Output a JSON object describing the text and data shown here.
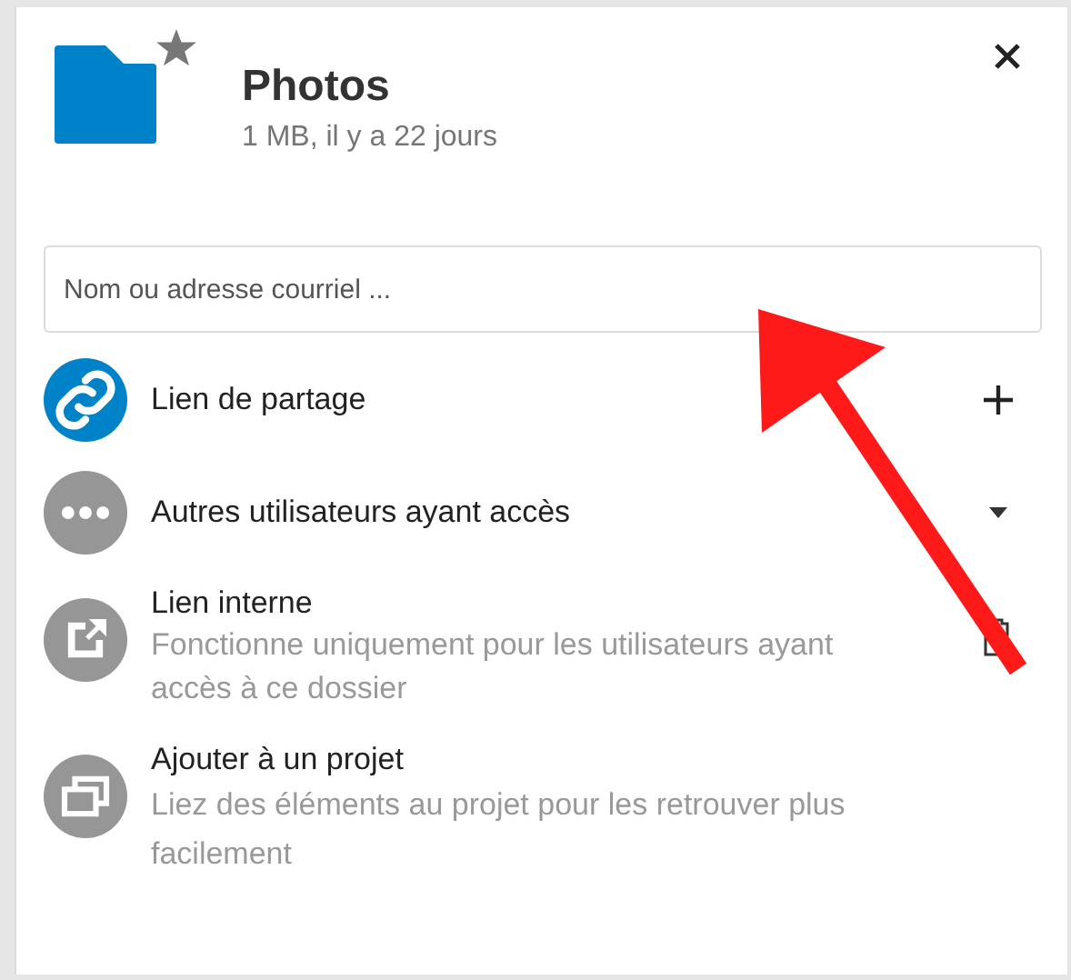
{
  "header": {
    "title": "Photos",
    "subtitle": "1 MB, il y a 22 jours",
    "favorite": true
  },
  "search": {
    "placeholder": "Nom ou adresse courriel ..."
  },
  "entries": [
    {
      "kind": "share",
      "title": "Lien de partage"
    },
    {
      "kind": "others",
      "title": "Autres utilisateurs ayant accès"
    },
    {
      "kind": "internal",
      "title": "Lien interne",
      "subtitle": "Fonctionne uniquement pour les utilisateurs ayant accès à ce dossier"
    },
    {
      "kind": "project",
      "title": "Ajouter à un projet",
      "subtitle": "Liez des éléments au projet pour les retrouver plus facilement"
    }
  ],
  "annotations": [
    {
      "kind": "arrow"
    }
  ]
}
